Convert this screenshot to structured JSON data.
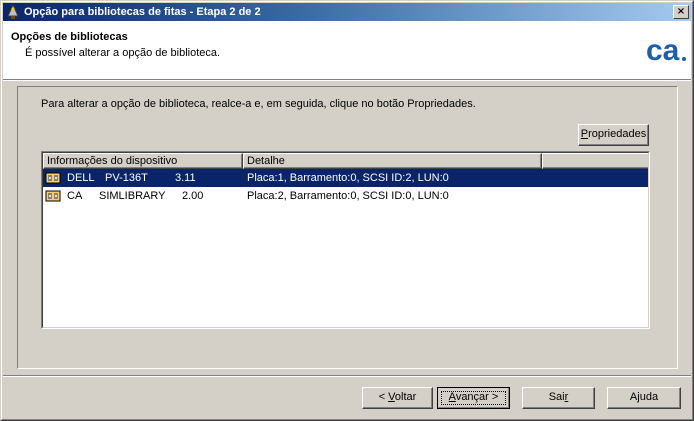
{
  "window": {
    "title": "Opção para bibliotecas de fitas - Etapa 2 de 2",
    "close_label": "×"
  },
  "header": {
    "title": "Opções de bibliotecas",
    "subtitle": "É possível alterar a opção de biblioteca.",
    "logo_text": "ca"
  },
  "main": {
    "instruction": "Para alterar a opção de biblioteca, realce-a e, em seguida, clique no botão Propriedades.",
    "properties_button": {
      "pre": "",
      "acc": "P",
      "post": "ropriedades"
    }
  },
  "device_list": {
    "columns": [
      "Informações do dispositivo",
      "Detalhe",
      ""
    ],
    "rows": [
      {
        "vendor": "DELL",
        "model": "PV-136T",
        "version": "3.11",
        "detail": "Placa:1, Barramento:0, SCSI ID:2, LUN:0",
        "selected": true
      },
      {
        "vendor": "CA",
        "model": "SIMLIBRARY",
        "version": "2.00",
        "detail": "Placa:2, Barramento:0, SCSI ID:0, LUN:0",
        "selected": false
      }
    ]
  },
  "footer": {
    "back_button": {
      "pre": "< ",
      "acc": "V",
      "post": "oltar"
    },
    "next_button": {
      "pre": "",
      "acc": "A",
      "post": "vançar >"
    },
    "exit_button": {
      "pre": "Sai",
      "acc": "r",
      "post": ""
    },
    "help_button": {
      "pre": "Ajuda",
      "acc": "",
      "post": ""
    }
  },
  "colors": {
    "selection": "#0a246a",
    "dialog_face": "#d4d0c8",
    "logo_blue": "#1f5fa8"
  },
  "icons": [
    "wizard-icon",
    "close-icon",
    "ca-logo",
    "tape-library-icon"
  ]
}
